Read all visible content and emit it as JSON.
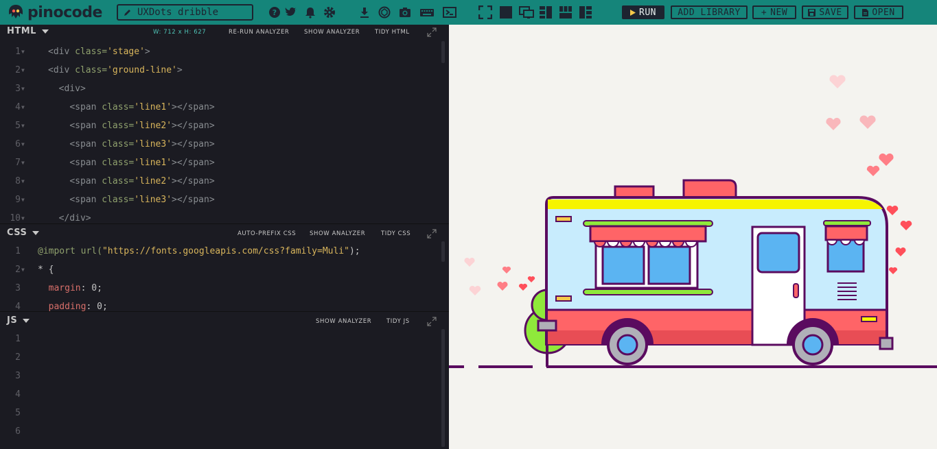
{
  "app": {
    "name": "pinocode",
    "project_title": "UXDots dribble"
  },
  "toolbar": {
    "icons": [
      "help-icon",
      "twitter-icon",
      "bell-icon",
      "gear-icon",
      "download-icon",
      "codepen-icon",
      "camera-icon",
      "keyboard-icon",
      "terminal-icon",
      "fullscreen-icon",
      "layout-single-icon",
      "layout-preview-icon",
      "layout-left-icon",
      "layout-grid-icon",
      "layout-right-icon"
    ],
    "run_label": "RUN",
    "add_library_label": "ADD LIBRARY",
    "new_label": "NEW",
    "save_label": "SAVE",
    "open_label": "OPEN"
  },
  "html_panel": {
    "title": "HTML",
    "dimensions": "W: 712 x H: 627",
    "rerun_label": "RE-RUN ANALYZER",
    "analyzer_label": "SHOW ANALYZER",
    "tidy_label": "TIDY HTML",
    "lines": [
      {
        "n": "1",
        "indent": "",
        "tag_open": "<div ",
        "attr": "class=",
        "val": "'stage'",
        "tail": ">"
      },
      {
        "n": "2",
        "indent": "",
        "tag_open": "<div ",
        "attr": "class=",
        "val": "'ground-line'",
        "tail": ">"
      },
      {
        "n": "3",
        "indent": "  ",
        "tag_open": "<div>",
        "attr": "",
        "val": "",
        "tail": ""
      },
      {
        "n": "4",
        "indent": "    ",
        "tag_open": "<span ",
        "attr": "class=",
        "val": "'line1'",
        "tail": "></span>"
      },
      {
        "n": "5",
        "indent": "    ",
        "tag_open": "<span ",
        "attr": "class=",
        "val": "'line2'",
        "tail": "></span>"
      },
      {
        "n": "6",
        "indent": "    ",
        "tag_open": "<span ",
        "attr": "class=",
        "val": "'line3'",
        "tail": "></span>"
      },
      {
        "n": "7",
        "indent": "    ",
        "tag_open": "<span ",
        "attr": "class=",
        "val": "'line1'",
        "tail": "></span>"
      },
      {
        "n": "8",
        "indent": "    ",
        "tag_open": "<span ",
        "attr": "class=",
        "val": "'line2'",
        "tail": "></span>"
      },
      {
        "n": "9",
        "indent": "    ",
        "tag_open": "<span ",
        "attr": "class=",
        "val": "'line3'",
        "tail": "></span>"
      },
      {
        "n": "10",
        "indent": "  ",
        "tag_open": "</div>",
        "attr": "",
        "val": "",
        "tail": ""
      }
    ]
  },
  "css_panel": {
    "title": "CSS",
    "autoprefix_label": "AUTO-PREFIX CSS",
    "analyzer_label": "SHOW ANALYZER",
    "tidy_label": "TIDY CSS",
    "lines": [
      {
        "n": "1",
        "a": "@import ",
        "b": "url(",
        "c": "\"https://fonts.googleapis.com/css?family=Muli\"",
        "d": ");"
      },
      {
        "n": "2",
        "a": "* {",
        "b": "",
        "c": "",
        "d": ""
      },
      {
        "n": "3",
        "a": "  margin",
        "b": ": ",
        "c": "0",
        "d": ";"
      },
      {
        "n": "4",
        "a": "  padding",
        "b": ": ",
        "c": "0",
        "d": ";"
      }
    ]
  },
  "js_panel": {
    "title": "JS",
    "analyzer_label": "SHOW ANALYZER",
    "tidy_label": "TIDY JS",
    "line_numbers": [
      "1",
      "2",
      "3",
      "4",
      "5",
      "6"
    ]
  },
  "colors": {
    "toolbar_bg": "#15857a",
    "editor_bg": "#1b1b22",
    "preview_bg": "#f4f3ef",
    "truck_red": "#ff6467",
    "truck_blue": "#c8ecfd",
    "truck_outline": "#5a0b5f",
    "roof_yellow": "#f6f400",
    "green": "#8fe93b"
  }
}
